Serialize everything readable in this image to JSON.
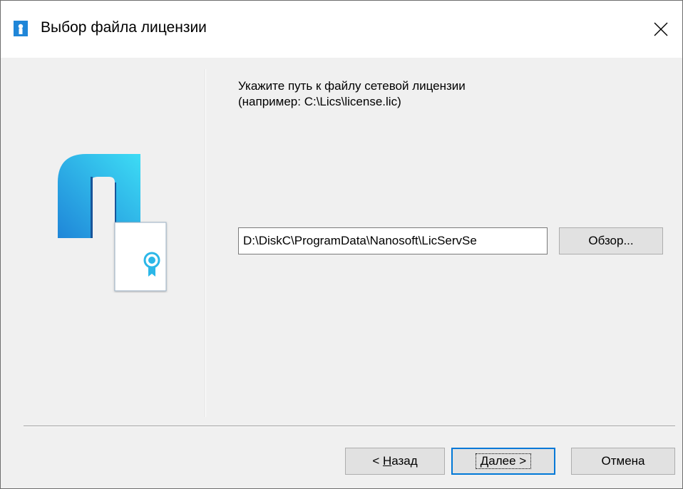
{
  "window": {
    "title": "Выбор файла лицензии",
    "title_icon": "license-app-icon",
    "close_icon": "close-icon"
  },
  "content": {
    "instruction_line1": "Укажите путь к файлу сетевой лицензии",
    "instruction_line2": "(например: C:\\Lics\\license.lic)",
    "path_value": "D:\\DiskC\\ProgramData\\Nanosoft\\LicServSe",
    "browse_label": "Обзор..."
  },
  "buttons": {
    "back_prefix": "< ",
    "back_mnemonic": "Н",
    "back_rest": "азад",
    "next_mnemonic": "Д",
    "next_rest": "алее >",
    "cancel_label": "Отмена"
  },
  "colors": {
    "accent": "#0078d7",
    "logo_cyan": "#3ddcf5",
    "logo_blue": "#1f86d8",
    "dialog_bg": "#f0f0f0"
  }
}
